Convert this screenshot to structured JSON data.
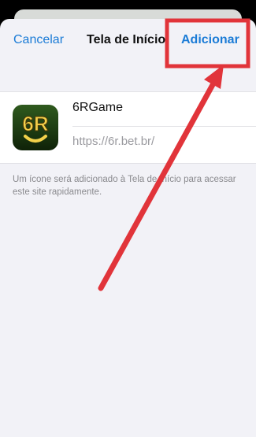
{
  "nav": {
    "cancel_label": "Cancelar",
    "title": "Tela de Início",
    "add_label": "Adicionar"
  },
  "bookmark": {
    "icon_text": "6R",
    "name": "6RGame",
    "url": "https://6r.bet.br/"
  },
  "caption": "Um ícone será adicionado à Tela de Início para acessar este site rapidamente.",
  "colors": {
    "accent": "#1a7bd6",
    "annotation": "#e1343a",
    "icon_bg": "#1c3b12",
    "icon_text": "#f2d14a"
  }
}
